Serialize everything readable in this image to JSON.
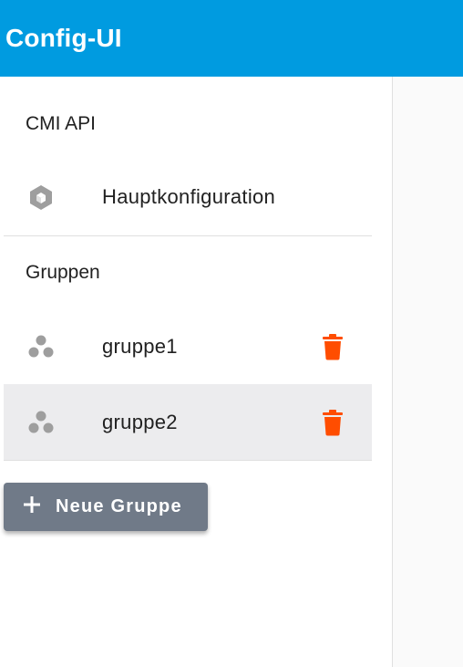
{
  "app": {
    "title": "Config-UI"
  },
  "sidebar": {
    "sections": {
      "api": "CMI API",
      "groups": "Gruppen"
    },
    "main_item": {
      "label": "Hauptkonfiguration",
      "icon": "cube-icon"
    },
    "groups": [
      {
        "label": "gruppe1",
        "icon": "group-icon",
        "delete_icon": "trash-icon",
        "selected": false
      },
      {
        "label": "gruppe2",
        "icon": "group-icon",
        "delete_icon": "trash-icon",
        "selected": true
      }
    ],
    "add_button": {
      "label": "Neue Gruppe",
      "icon": "plus-icon"
    }
  },
  "colors": {
    "appbar": "#009be0",
    "delete": "#ff4d00",
    "icon": "#9e9e9e",
    "add_button": "#707a88",
    "selected_row": "#ececee"
  }
}
